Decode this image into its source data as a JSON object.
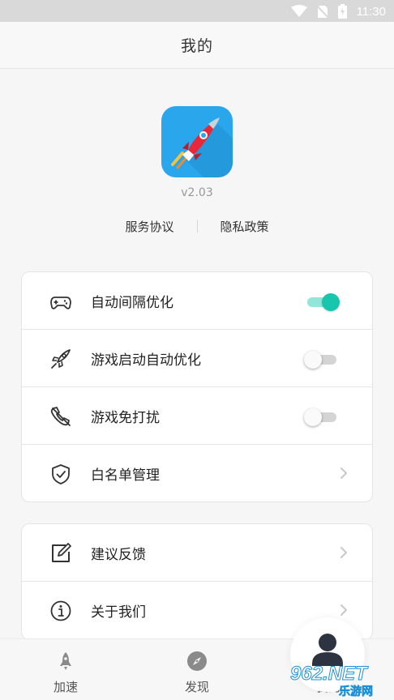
{
  "status_bar": {
    "time": "11:30"
  },
  "header": {
    "title": "我的"
  },
  "app": {
    "version": "v2.03"
  },
  "links": {
    "service": "服务协议",
    "privacy": "隐私政策"
  },
  "settings": [
    {
      "label": "自动间隔优化",
      "control": "toggle",
      "on": true
    },
    {
      "label": "游戏启动自动优化",
      "control": "toggle",
      "on": false
    },
    {
      "label": "游戏免打扰",
      "control": "toggle",
      "on": false
    },
    {
      "label": "白名单管理",
      "control": "chevron"
    }
  ],
  "more": [
    {
      "label": "建议反馈",
      "control": "chevron"
    },
    {
      "label": "关于我们",
      "control": "chevron"
    }
  ],
  "tabs": [
    {
      "label": "加速",
      "icon": "rocket-icon"
    },
    {
      "label": "发现",
      "icon": "compass-icon"
    },
    {
      "label": "我的",
      "icon": "person-icon"
    }
  ],
  "watermark": {
    "text": "962.NET",
    "subtext": "乐游网"
  },
  "colors": {
    "accent": "#18c6ae",
    "logo_bg": "#2aa6ec",
    "rocket": "#e8283a"
  }
}
